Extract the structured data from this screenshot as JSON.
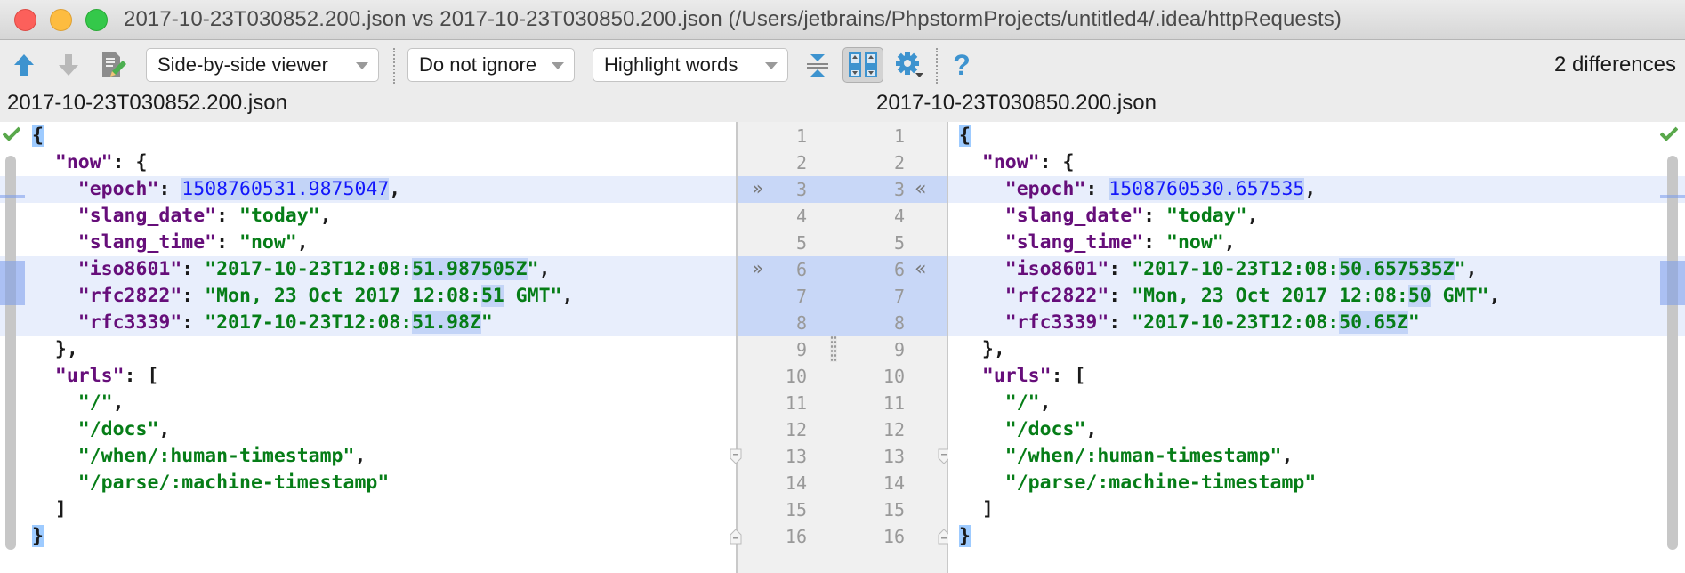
{
  "window": {
    "title": "2017-10-23T030852.200.json vs 2017-10-23T030850.200.json (/Users/jetbrains/PhpstormProjects/untitled4/.idea/httpRequests)"
  },
  "toolbar": {
    "prev_diff_icon": "arrow-up-icon",
    "next_diff_icon": "arrow-down-icon",
    "edit_source_icon": "edit-source-icon",
    "viewer_mode": "Side-by-side viewer",
    "ignore_mode": "Do not ignore",
    "highlight_mode": "Highlight words",
    "collapse_icon": "collapse-unchanged-icon",
    "sync_scroll_icon": "synchronize-scrolling-icon",
    "settings_icon": "gear-icon",
    "help_icon": "help-icon",
    "help_label": "?",
    "differences_count": "2 differences"
  },
  "colors": {
    "changed_line_bg": "#e8eefc",
    "changed_word_bg": "#c3d4f7",
    "gutter_changed_bg": "#c8d7f7",
    "key_color": "#660e7a",
    "string_color": "#067d17",
    "number_color": "#1317fb",
    "check_color": "#59a84b"
  },
  "left": {
    "filename": "2017-10-23T030852.200.json",
    "lines": [
      [
        {
          "t": "{",
          "c": "brace-hl"
        }
      ],
      [
        {
          "t": "  "
        },
        {
          "t": "\"now\"",
          "c": "k"
        },
        {
          "t": ": {"
        }
      ],
      [
        {
          "t": "    "
        },
        {
          "t": "\"epoch\"",
          "c": "k"
        },
        {
          "t": ": "
        },
        {
          "t": "1508760531.9875047",
          "c": "n hl"
        },
        {
          "t": ","
        }
      ],
      [
        {
          "t": "    "
        },
        {
          "t": "\"slang_date\"",
          "c": "k"
        },
        {
          "t": ": "
        },
        {
          "t": "\"today\"",
          "c": "s"
        },
        {
          "t": ","
        }
      ],
      [
        {
          "t": "    "
        },
        {
          "t": "\"slang_time\"",
          "c": "k"
        },
        {
          "t": ": "
        },
        {
          "t": "\"now\"",
          "c": "s"
        },
        {
          "t": ","
        }
      ],
      [
        {
          "t": "    "
        },
        {
          "t": "\"iso8601\"",
          "c": "k"
        },
        {
          "t": ": "
        },
        {
          "t": "\"2017-10-23T12:08:",
          "c": "s"
        },
        {
          "t": "51.987505Z",
          "c": "s hl"
        },
        {
          "t": "\"",
          "c": "s"
        },
        {
          "t": ","
        }
      ],
      [
        {
          "t": "    "
        },
        {
          "t": "\"rfc2822\"",
          "c": "k"
        },
        {
          "t": ": "
        },
        {
          "t": "\"Mon, 23 Oct 2017 12:08:",
          "c": "s"
        },
        {
          "t": "51",
          "c": "s hl"
        },
        {
          "t": " GMT\"",
          "c": "s"
        },
        {
          "t": ","
        }
      ],
      [
        {
          "t": "    "
        },
        {
          "t": "\"rfc3339\"",
          "c": "k"
        },
        {
          "t": ": "
        },
        {
          "t": "\"2017-10-23T12:08:",
          "c": "s"
        },
        {
          "t": "51.98Z",
          "c": "s hl"
        },
        {
          "t": "\"",
          "c": "s"
        }
      ],
      [
        {
          "t": "  },"
        }
      ],
      [
        {
          "t": "  "
        },
        {
          "t": "\"urls\"",
          "c": "k"
        },
        {
          "t": ": ["
        }
      ],
      [
        {
          "t": "    "
        },
        {
          "t": "\"/\"",
          "c": "s"
        },
        {
          "t": ","
        }
      ],
      [
        {
          "t": "    "
        },
        {
          "t": "\"/docs\"",
          "c": "s"
        },
        {
          "t": ","
        }
      ],
      [
        {
          "t": "    "
        },
        {
          "t": "\"/when/:human-timestamp\"",
          "c": "s"
        },
        {
          "t": ","
        }
      ],
      [
        {
          "t": "    "
        },
        {
          "t": "\"/parse/:machine-timestamp\"",
          "c": "s"
        }
      ],
      [
        {
          "t": "  ]"
        }
      ],
      [
        {
          "t": "}",
          "c": "brace-hl"
        }
      ]
    ]
  },
  "right": {
    "filename": "2017-10-23T030850.200.json",
    "lines": [
      [
        {
          "t": "{",
          "c": "brace-hl"
        }
      ],
      [
        {
          "t": "  "
        },
        {
          "t": "\"now\"",
          "c": "k"
        },
        {
          "t": ": {"
        }
      ],
      [
        {
          "t": "    "
        },
        {
          "t": "\"epoch\"",
          "c": "k"
        },
        {
          "t": ": "
        },
        {
          "t": "1508760530.657535",
          "c": "n hl"
        },
        {
          "t": ","
        }
      ],
      [
        {
          "t": "    "
        },
        {
          "t": "\"slang_date\"",
          "c": "k"
        },
        {
          "t": ": "
        },
        {
          "t": "\"today\"",
          "c": "s"
        },
        {
          "t": ","
        }
      ],
      [
        {
          "t": "    "
        },
        {
          "t": "\"slang_time\"",
          "c": "k"
        },
        {
          "t": ": "
        },
        {
          "t": "\"now\"",
          "c": "s"
        },
        {
          "t": ","
        }
      ],
      [
        {
          "t": "    "
        },
        {
          "t": "\"iso8601\"",
          "c": "k"
        },
        {
          "t": ": "
        },
        {
          "t": "\"2017-10-23T12:08:",
          "c": "s"
        },
        {
          "t": "50.657535Z",
          "c": "s hl"
        },
        {
          "t": "\"",
          "c": "s"
        },
        {
          "t": ","
        }
      ],
      [
        {
          "t": "    "
        },
        {
          "t": "\"rfc2822\"",
          "c": "k"
        },
        {
          "t": ": "
        },
        {
          "t": "\"Mon, 23 Oct 2017 12:08:",
          "c": "s"
        },
        {
          "t": "50",
          "c": "s hl"
        },
        {
          "t": " GMT\"",
          "c": "s"
        },
        {
          "t": ","
        }
      ],
      [
        {
          "t": "    "
        },
        {
          "t": "\"rfc3339\"",
          "c": "k"
        },
        {
          "t": ": "
        },
        {
          "t": "\"2017-10-23T12:08:",
          "c": "s"
        },
        {
          "t": "50.65Z",
          "c": "s hl"
        },
        {
          "t": "\"",
          "c": "s"
        }
      ],
      [
        {
          "t": "  },"
        }
      ],
      [
        {
          "t": "  "
        },
        {
          "t": "\"urls\"",
          "c": "k"
        },
        {
          "t": ": ["
        }
      ],
      [
        {
          "t": "    "
        },
        {
          "t": "\"/\"",
          "c": "s"
        },
        {
          "t": ","
        }
      ],
      [
        {
          "t": "    "
        },
        {
          "t": "\"/docs\"",
          "c": "s"
        },
        {
          "t": ","
        }
      ],
      [
        {
          "t": "    "
        },
        {
          "t": "\"/when/:human-timestamp\"",
          "c": "s"
        },
        {
          "t": ","
        }
      ],
      [
        {
          "t": "    "
        },
        {
          "t": "\"/parse/:machine-timestamp\"",
          "c": "s"
        }
      ],
      [
        {
          "t": "  ]"
        }
      ],
      [
        {
          "t": "}",
          "c": "brace-hl"
        }
      ]
    ]
  },
  "changed_lines": [
    3,
    6,
    7,
    8
  ],
  "change_starts": [
    3,
    6
  ],
  "gutter": {
    "line_numbers": [
      "1",
      "2",
      "3",
      "4",
      "5",
      "6",
      "7",
      "8",
      "9",
      "10",
      "11",
      "12",
      "13",
      "14",
      "15",
      "16"
    ],
    "apply_right_glyph": "»",
    "apply_left_glyph": "«",
    "fold_lines": [
      13,
      16
    ]
  }
}
